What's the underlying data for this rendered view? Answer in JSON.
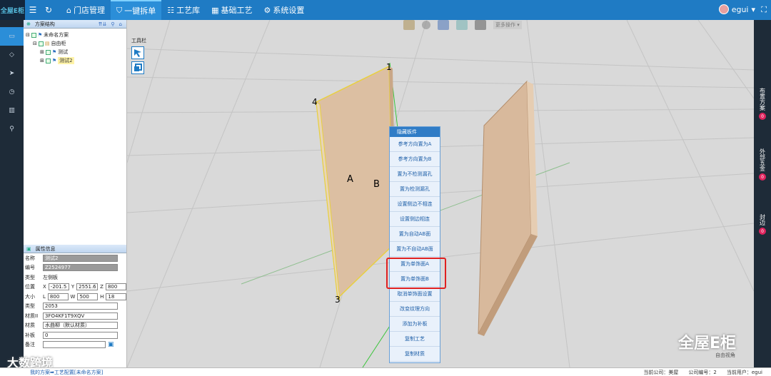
{
  "topbar": {
    "logo": "全屋E柜",
    "nav": [
      "门店管理",
      "一键拆单",
      "工艺库",
      "基础工艺",
      "系统设置"
    ],
    "active": 1,
    "user": "egui"
  },
  "tree": {
    "title": "方案结构",
    "rows": [
      {
        "label": "未命名方案",
        "indent": 0
      },
      {
        "label": "自由柜",
        "indent": 1
      },
      {
        "label": "测试",
        "indent": 2
      },
      {
        "label": "测试2",
        "indent": 2,
        "selected": true
      }
    ]
  },
  "props": {
    "title": "属性信息",
    "name_label": "名称",
    "name_value": "测试2",
    "code_label": "编号",
    "code_value": "Z2524977",
    "type_label": "类型",
    "type_value": "左侧板",
    "pos_label": "位置",
    "pos_x": "-201.5",
    "pos_y": "2551.6",
    "pos_z": "800",
    "size_label": "大小",
    "size_l": "800",
    "size_w": "500",
    "size_h": "18",
    "kind_label": "类型",
    "kind_value": "2053",
    "matcode_label": "材质II",
    "matcode_value": "3FO4KF1T9XQV",
    "mat_label": "材质",
    "mat_value": "水曲柳（默认材质）",
    "patch_label": "补板",
    "patch_value": "0",
    "note_label": "备注",
    "note_value": ""
  },
  "viewport": {
    "toolbox_label": "工具栏",
    "more_ops": "更多操作",
    "corner_labels": [
      "1",
      "4",
      "3"
    ],
    "face_labels": [
      "A",
      "B"
    ],
    "view_mode": "自由视角"
  },
  "context_menu": {
    "title": "隐藏板件",
    "items": [
      "参考方向置为A",
      "参考方向置为B",
      "置为不检测漏孔",
      "置为检测漏孔",
      "设置侧边不相连",
      "设置侧边相连",
      "置为自动AB面",
      "置为不自动AB面",
      "置为单饰面A",
      "置为单饰面B",
      "取消单饰面设置",
      "改变纹理方向",
      "添加为补板",
      "复制工艺",
      "复制材质"
    ]
  },
  "rightbar": {
    "tabs": [
      {
        "label": "布置方案",
        "count": "0"
      },
      {
        "label": "外部五金",
        "count": "0"
      },
      {
        "label": "封边",
        "count": "0"
      }
    ]
  },
  "statusbar": {
    "breadcrumb": "我的方案➡工艺配置[未命名方案]",
    "company": "当前公司：美屋",
    "company_code": "公司编号：2",
    "user": "当前用户：egui"
  },
  "watermarks": {
    "left": "大数跨境",
    "right": "全屋E柜"
  }
}
